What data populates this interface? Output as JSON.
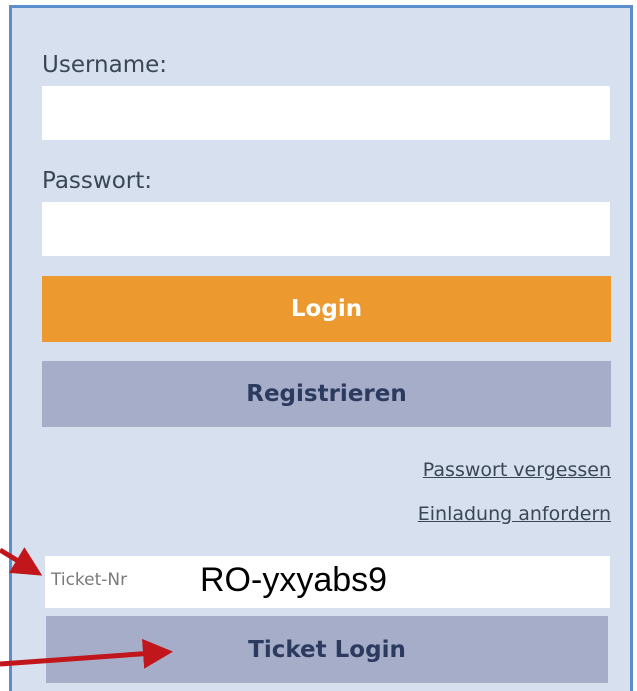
{
  "form": {
    "username_label": "Username:",
    "username_value": "",
    "password_label": "Passwort:",
    "password_value": "",
    "login_label": "Login",
    "register_label": "Registrieren",
    "forgot_password_link": "Passwort vergessen",
    "request_invite_link": "Einladung anfordern",
    "ticket_placeholder": "Ticket-Nr",
    "ticket_value": "RO-yxyabs9",
    "ticket_login_label": "Ticket Login"
  },
  "colors": {
    "panel_bg": "#d7e0ee",
    "panel_border": "#5b8fcc",
    "login_button": "#ec9a2f",
    "secondary_button": "#a6adc8",
    "annotation_arrow": "#c0161c"
  }
}
